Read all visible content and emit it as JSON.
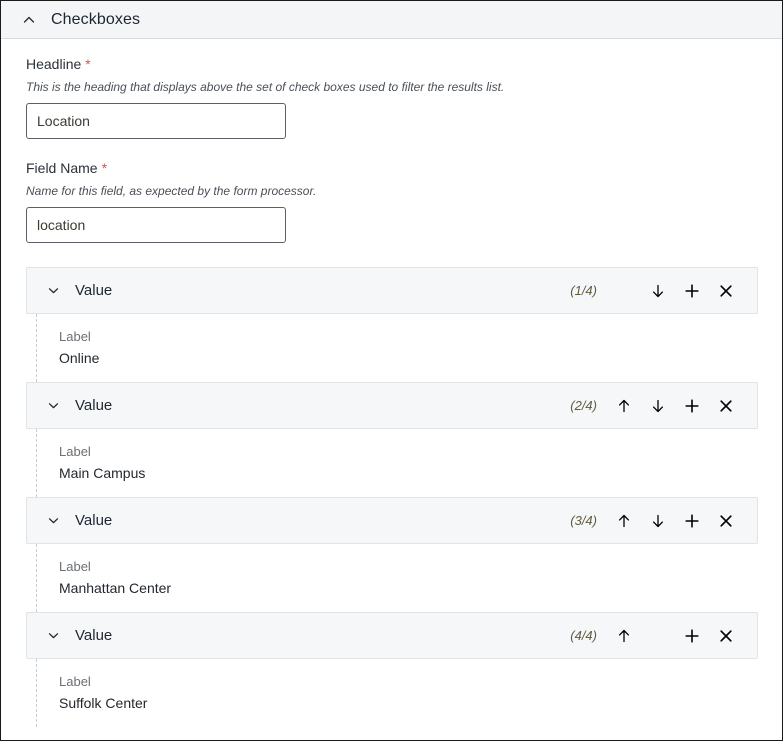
{
  "panel": {
    "title": "Checkboxes",
    "collapse_icon": "chevron-up-icon"
  },
  "fields": [
    {
      "label": "Headline",
      "required_marker": "*",
      "help": "This is the heading that displays above the set of check boxes used to filter the results list.",
      "value": "Location",
      "placeholder": ""
    },
    {
      "label": "Field Name",
      "required_marker": "*",
      "help": "Name for this field, as expected by the form processor.",
      "value": "location",
      "placeholder": ""
    }
  ],
  "items": [
    {
      "title": "Value",
      "counter": "(1/4)",
      "show_up": false,
      "show_down": true,
      "content_label": "Label",
      "content_value": "Online"
    },
    {
      "title": "Value",
      "counter": "(2/4)",
      "show_up": true,
      "show_down": true,
      "content_label": "Label",
      "content_value": "Main Campus"
    },
    {
      "title": "Value",
      "counter": "(3/4)",
      "show_up": true,
      "show_down": true,
      "content_label": "Label",
      "content_value": "Manhattan Center"
    },
    {
      "title": "Value",
      "counter": "(4/4)",
      "show_up": true,
      "show_down": false,
      "content_label": "Label",
      "content_value": "Suffolk Center"
    }
  ],
  "icons": {
    "expand": "chevron-down-icon",
    "move_up": "arrow-up-icon",
    "move_down": "arrow-down-icon",
    "add": "plus-icon",
    "remove": "close-x-icon"
  },
  "colors": {
    "required": "#d9534f",
    "add": "#4caf72",
    "remove": "#e05b57",
    "arrow": "#3b424b",
    "header_bg": "#f4f5f6",
    "row_bg": "#f6f7f8"
  }
}
